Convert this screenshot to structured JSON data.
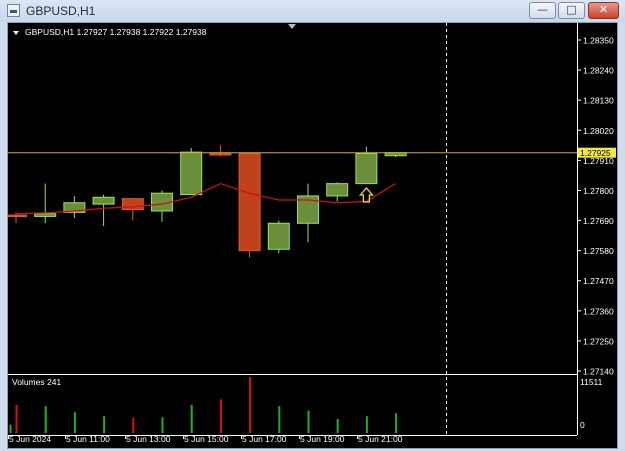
{
  "window": {
    "title": "GBPUSD,H1",
    "minimize_icon": "minimize-icon",
    "maximize_icon": "maximize-icon",
    "close_icon": "close-icon",
    "minimize_glyph": "—",
    "maximize_glyph": "□",
    "close_glyph": "✕"
  },
  "chart": {
    "header_text": "GBPUSD,H1  1.27927 1.27938 1.27922 1.27938",
    "symbol": "GBPUSD",
    "timeframe": "H1",
    "quote": {
      "open": 1.27927,
      "high": 1.27938,
      "low": 1.27922,
      "close": 1.27938
    },
    "current_price_label": "1.27925",
    "volumes_label": "Volumes 241",
    "volume_axis": [
      "11511",
      "0"
    ],
    "colors": {
      "background": "#000000",
      "bull": "#6b8e3a",
      "bear": "#c0421a",
      "bull_border": "#9be05a",
      "bear_border": "#e05a2a",
      "ma": "#d01010",
      "price_line": "#c8b030",
      "grid": "#ffffff"
    }
  },
  "chart_data": {
    "type": "candlestick",
    "y_ticks": [
      "1.28350",
      "1.28240",
      "1.28130",
      "1.28020",
      "1.27910",
      "1.27800",
      "1.27690",
      "1.27580",
      "1.27470",
      "1.27360",
      "1.27250",
      "1.27140"
    ],
    "x_labels": [
      "5 Jun 2024",
      "5 Jun 11:00",
      "5 Jun 13:00",
      "5 Jun 15:00",
      "5 Jun 17:00",
      "5 Jun 19:00",
      "5 Jun 21:00"
    ],
    "ylim": [
      1.2714,
      1.2835
    ],
    "candles": [
      {
        "o": 1.2771,
        "h": 1.2772,
        "l": 1.2768,
        "c": 1.27705
      },
      {
        "o": 1.27705,
        "h": 1.27825,
        "l": 1.2768,
        "c": 1.27715
      },
      {
        "o": 1.2772,
        "h": 1.2778,
        "l": 1.277,
        "c": 1.27755
      },
      {
        "o": 1.2775,
        "h": 1.27785,
        "l": 1.2767,
        "c": 1.27775
      },
      {
        "o": 1.2777,
        "h": 1.2777,
        "l": 1.2769,
        "c": 1.2773
      },
      {
        "o": 1.27725,
        "h": 1.278,
        "l": 1.27685,
        "c": 1.2779
      },
      {
        "o": 1.27785,
        "h": 1.27955,
        "l": 1.27785,
        "c": 1.2794
      },
      {
        "o": 1.27935,
        "h": 1.27965,
        "l": 1.27925,
        "c": 1.2793
      },
      {
        "o": 1.27935,
        "h": 1.27935,
        "l": 1.27555,
        "c": 1.2758
      },
      {
        "o": 1.27585,
        "h": 1.2769,
        "l": 1.2757,
        "c": 1.2768
      },
      {
        "o": 1.2768,
        "h": 1.27825,
        "l": 1.2761,
        "c": 1.2778
      },
      {
        "o": 1.2778,
        "h": 1.2783,
        "l": 1.2776,
        "c": 1.27825
      },
      {
        "o": 1.27825,
        "h": 1.2796,
        "l": 1.27825,
        "c": 1.27935
      },
      {
        "o": 1.27927,
        "h": 1.27938,
        "l": 1.27922,
        "c": 1.27938
      }
    ],
    "ma": [
      1.27715,
      1.27718,
      1.27725,
      1.27735,
      1.2774,
      1.2775,
      1.27775,
      1.27825,
      1.2779,
      1.27765,
      1.27765,
      1.27755,
      1.2776,
      1.27825
    ],
    "volumes": [
      0.15,
      0.5,
      0.48,
      0.37,
      0.3,
      0.27,
      0.28,
      0.5,
      0.6,
      1.0,
      0.48,
      0.4,
      0.25,
      0.3,
      0.35
    ]
  }
}
